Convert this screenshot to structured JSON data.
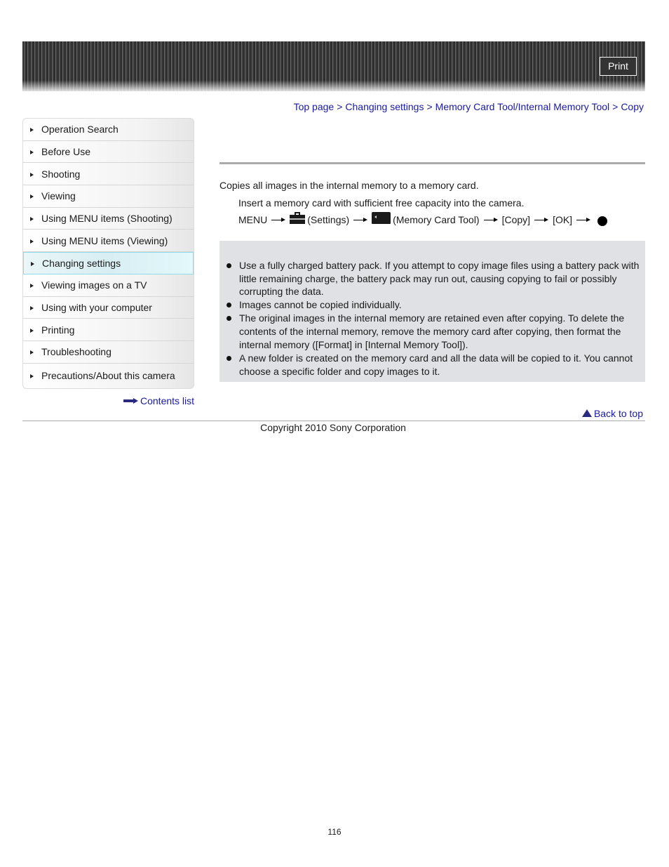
{
  "header": {
    "print_label": "Print"
  },
  "breadcrumb": {
    "items": [
      "Top page",
      "Changing settings",
      "Memory Card Tool/Internal Memory Tool",
      "Copy"
    ],
    "separator": ">"
  },
  "sidebar": {
    "active_index": 6,
    "items": [
      {
        "label": "Operation Search"
      },
      {
        "label": "Before Use"
      },
      {
        "label": "Shooting"
      },
      {
        "label": "Viewing"
      },
      {
        "label": "Using MENU items (Shooting)"
      },
      {
        "label": "Using MENU items (Viewing)"
      },
      {
        "label": "Changing settings"
      },
      {
        "label": "Viewing images on a TV"
      },
      {
        "label": "Using with your computer"
      },
      {
        "label": "Printing"
      },
      {
        "label": "Troubleshooting"
      },
      {
        "label": "Precautions/About this camera"
      }
    ],
    "contents_link": "Contents list"
  },
  "main": {
    "intro": "Copies all images in the internal memory to a memory card.",
    "step1": "Insert a memory card with sufficient free capacity into the camera.",
    "step2": {
      "menu": "MENU",
      "settings_icon": "toolbox-icon",
      "settings_label": "(Settings)",
      "card_icon": "memory-card-icon",
      "card_label": "(Memory Card Tool)",
      "copy": "[Copy]",
      "ok": "[OK]",
      "final_icon": "center-button-dot-icon"
    },
    "notes": [
      "Use a fully charged battery pack. If you attempt to copy image files using a battery pack with little remaining charge, the battery pack may run out, causing copying to fail or possibly corrupting the data.",
      "Images cannot be copied individually.",
      "The original images in the internal memory are retained even after copying. To delete the contents of the internal memory, remove the memory card after copying, then format the internal memory ([Format] in [Internal Memory Tool]).",
      "A new folder is created on the memory card and all the data will be copied to it. You cannot choose a specific folder and copy images to it."
    ]
  },
  "footer": {
    "back_to_top": "Back to top",
    "copyright": "Copyright 2010 Sony Corporation",
    "page_number": "116"
  },
  "colors": {
    "link": "#1a1a9c",
    "notes_background": "#dfe1e5",
    "active_nav": "#d8eef2"
  }
}
